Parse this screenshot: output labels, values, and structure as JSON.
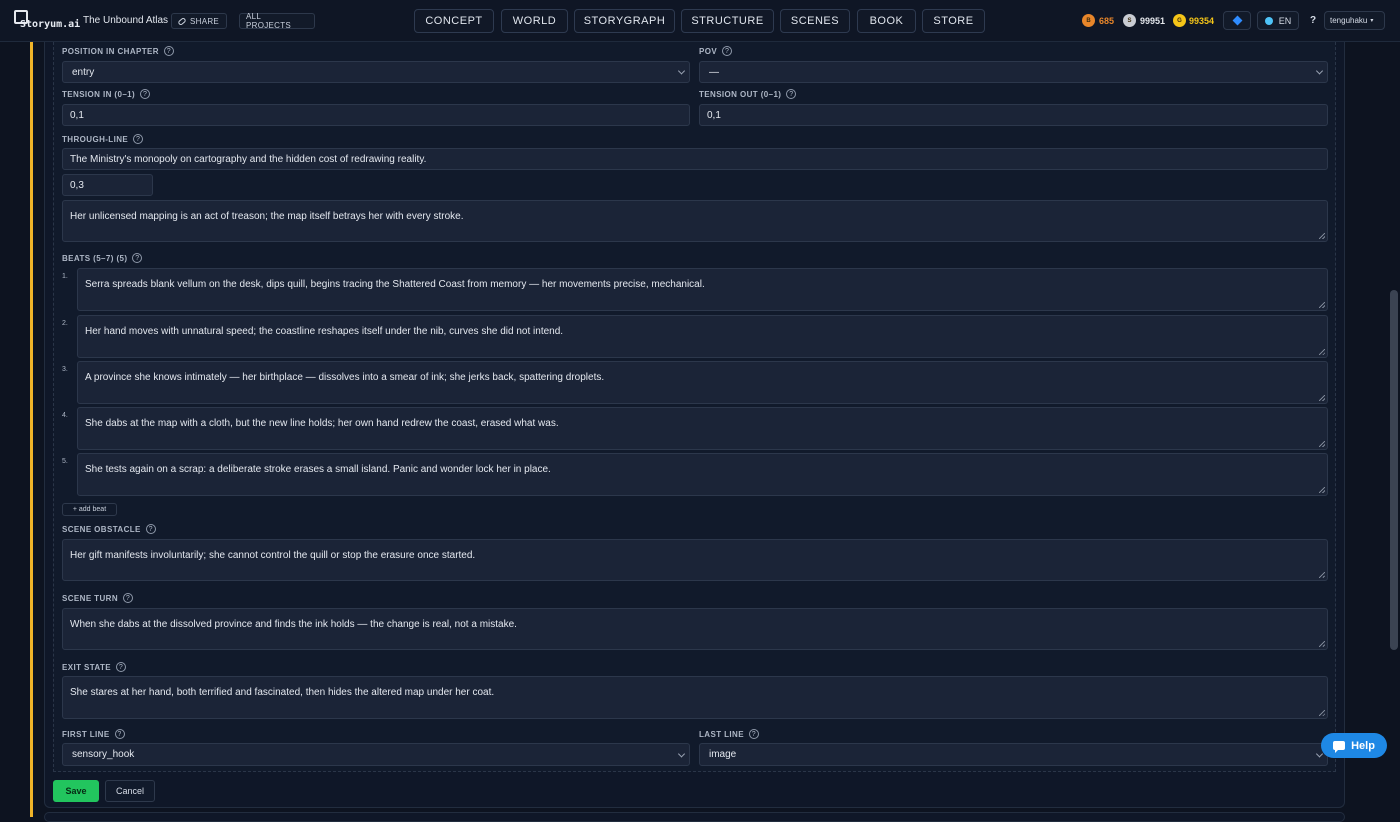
{
  "header": {
    "logo_text": "Storyum.ai",
    "project_title": "The Unbound Atlas",
    "share_label": "SHARE",
    "all_projects_label": "ALL PROJECTS",
    "tabs": [
      "CONCEPT",
      "WORLD",
      "STORYGRAPH",
      "STRUCTURE",
      "SCENES",
      "BOOK",
      "STORE"
    ],
    "bronze_value": "685",
    "bronze_letter": "B",
    "silver_value": "99951",
    "silver_letter": "S",
    "gold_value": "99354",
    "gold_letter": "G",
    "language": "EN",
    "help_q": "?",
    "username": "tenguhaku",
    "colors": {
      "bronze": "#e8862a",
      "silver": "#c9ccd3",
      "gold": "#f5c518",
      "accent": "#f0b429"
    }
  },
  "form": {
    "q": "?",
    "position_label": "POSITION IN CHAPTER",
    "position_value": "entry",
    "pov_label": "POV",
    "pov_value": "—",
    "tension_in_label": "TENSION IN (0–1)",
    "tension_in_value": "0,1",
    "tension_out_label": "TENSION OUT (0–1)",
    "tension_out_value": "0,1",
    "through_line_label": "THROUGH-LINE",
    "through_line_value": "The Ministry's monopoly on cartography and the hidden cost of redrawing reality.",
    "through_line_weight": "0,3",
    "through_line_note": "Her unlicensed mapping is an act of treason; the map itself betrays her with every stroke.",
    "beats_label": "BEATS (5–7) (5)",
    "beats": [
      {
        "num": "1.",
        "text": "Serra spreads blank vellum on the desk, dips quill, begins tracing the Shattered Coast from memory — her movements precise, mechanical."
      },
      {
        "num": "2.",
        "text": "Her hand moves with unnatural speed; the coastline reshapes itself under the nib, curves she did not intend."
      },
      {
        "num": "3.",
        "text": "A province she knows intimately — her birthplace — dissolves into a smear of ink; she jerks back, spattering droplets."
      },
      {
        "num": "4.",
        "text": "She dabs at the map with a cloth, but the new line holds; her own hand redrew the coast, erased what was."
      },
      {
        "num": "5.",
        "text": "She tests again on a scrap: a deliberate stroke erases a small island. Panic and wonder lock her in place."
      }
    ],
    "add_beat_label": "+ add beat",
    "obstacle_label": "SCENE OBSTACLE",
    "obstacle_value": "Her gift manifests involuntarily; she cannot control the quill or stop the erasure once started.",
    "turn_label": "SCENE TURN",
    "turn_value": "When she dabs at the dissolved province and finds the ink holds — the change is real, not a mistake.",
    "exit_label": "EXIT STATE",
    "exit_value": "She stares at her hand, both terrified and fascinated, then hides the altered map under her coat.",
    "first_line_label": "FIRST LINE",
    "first_line_value": "sensory_hook",
    "last_line_label": "LAST LINE",
    "last_line_value": "image",
    "save_label": "Save",
    "cancel_label": "Cancel"
  },
  "help_label": "Help"
}
